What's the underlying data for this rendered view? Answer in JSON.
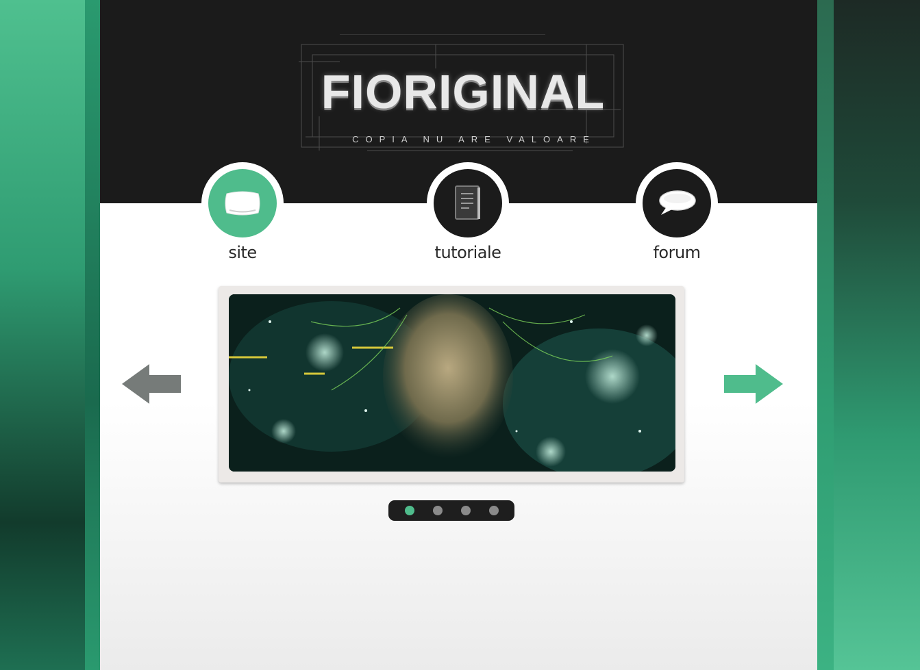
{
  "logo": {
    "title": "FIORIGINAL",
    "tagline": "COPIA NU ARE VALOARE"
  },
  "nav": {
    "items": [
      {
        "label": "site",
        "icon": "pillow-icon",
        "active": true
      },
      {
        "label": "tutoriale",
        "icon": "book-icon",
        "active": false
      },
      {
        "label": "forum",
        "icon": "speech-bubble-icon",
        "active": false
      }
    ]
  },
  "slider": {
    "slide_count": 4,
    "active_index": 0
  },
  "colors": {
    "accent": "#4fbc8c",
    "header_bg": "#1b1b1b",
    "arrow_prev": "#767b79",
    "arrow_next": "#4fbc8c"
  }
}
